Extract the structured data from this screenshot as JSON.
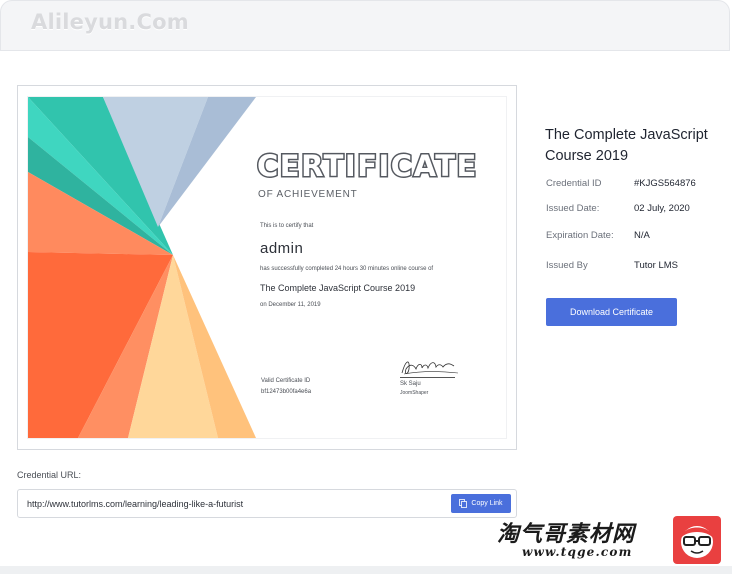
{
  "header": {
    "logo_text": "Alileyun.Com"
  },
  "certificate": {
    "title": "CERTIFICATE",
    "subtitle": "OF ACHIEVEMENT",
    "certify_text": "This is to certify that",
    "recipient": "admin",
    "completion_text": "has successfully completed 24 hours 30 minutes online course of",
    "course_name": "The Complete JavaScript Course 2019",
    "date_text": "on December 11, 2019",
    "valid_id_label": "Valid Certificate ID",
    "valid_id_value": "bf12473b00fa4e6a",
    "signer_name": "Sk Saju",
    "signer_org": "JoomShaper",
    "colors": {
      "teal": "#35c9b0",
      "orange": "#ff6a3d",
      "peach": "#ffc98a",
      "blue": "#b9cbe0"
    }
  },
  "details": {
    "course_title": "The Complete JavaScript Course 2019",
    "rows": [
      {
        "label": "Credential ID",
        "value": "#KJGS564876"
      },
      {
        "label": "Issued Date:",
        "value": "02 July, 2020"
      },
      {
        "label": "Expiration Date:",
        "value": "N/A"
      },
      {
        "label": "Issued By",
        "value": "Tutor LMS"
      }
    ],
    "download_label": "Download Certificate"
  },
  "credential": {
    "label": "Credential URL:",
    "url": "http://www.tutorlms.com/learning/leading-like-a-futurist",
    "copy_label": "Copy Link"
  },
  "watermark": {
    "text": "淘气哥素材网",
    "url": "www.tqge.com"
  },
  "accent_color": "#4a6fdc"
}
